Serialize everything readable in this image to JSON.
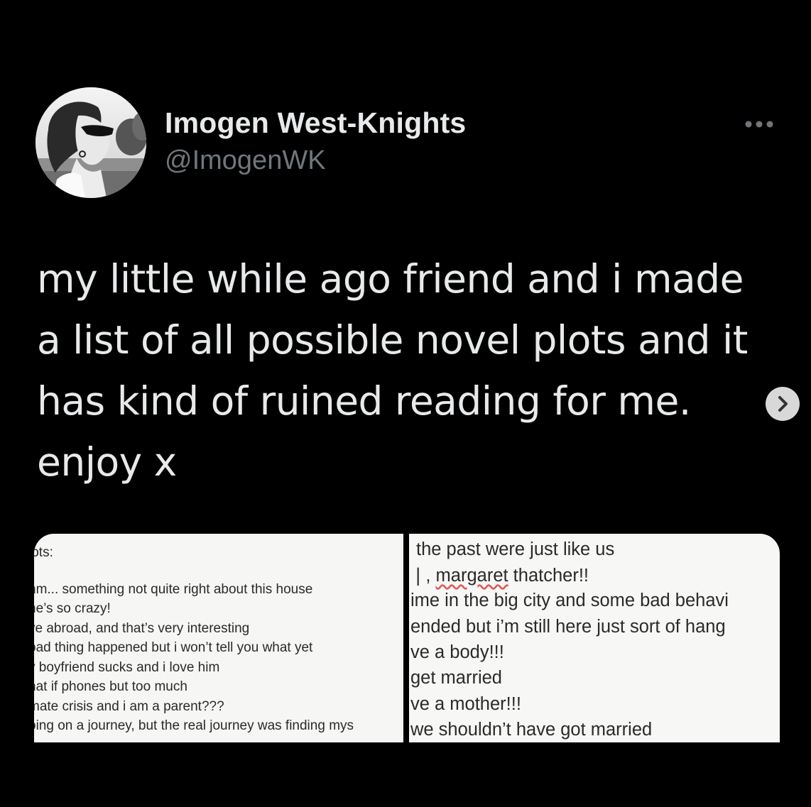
{
  "author": {
    "display_name": "Imogen West-Knights",
    "handle": "@ImogenWK"
  },
  "tweet": {
    "lines": [
      "my little while ago friend and i made",
      "a list of all possible novel plots and it",
      "has kind of ruined reading for me.",
      "enjoy x"
    ]
  },
  "icons": {
    "more": "more-horizontal-icon",
    "next": "chevron-right-icon"
  },
  "media": {
    "left_lines": [
      "lots:",
      "hm... something not quite right about this house",
      "he’s so crazy!",
      "ve abroad, and that’s very interesting",
      "bad thing happened but i won’t tell you what yet",
      "y boyfriend sucks and i love him",
      "hat if phones but too much",
      "mate crisis and i am a parent???",
      "oing on a journey, but the real journey was finding mys"
    ],
    "right_lines": [
      "the past were just like us",
      "margaret",
      " thatcher!!",
      "ime in the big city and some bad behavi",
      " ended but i’m still here just sort of hang",
      "ve a body!!!",
      "get married",
      "ve a mother!!!",
      "we shouldn’t have got married"
    ],
    "right_line2_prefix": "❘, "
  }
}
